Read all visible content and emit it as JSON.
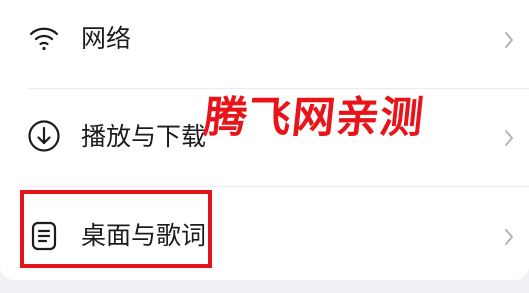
{
  "settings_list": {
    "items": [
      {
        "label": "网络",
        "icon": "wifi-icon"
      },
      {
        "label": "播放与下载",
        "icon": "download-circle-icon"
      },
      {
        "label": "桌面与歌词",
        "icon": "lyrics-document-icon"
      }
    ]
  },
  "watermark": {
    "text": "腾飞网亲测"
  },
  "colors": {
    "watermark": "#e8141a",
    "highlight_border": "#e5141a",
    "chevron": "#b4b4bb",
    "text": "#1c1c1e"
  }
}
